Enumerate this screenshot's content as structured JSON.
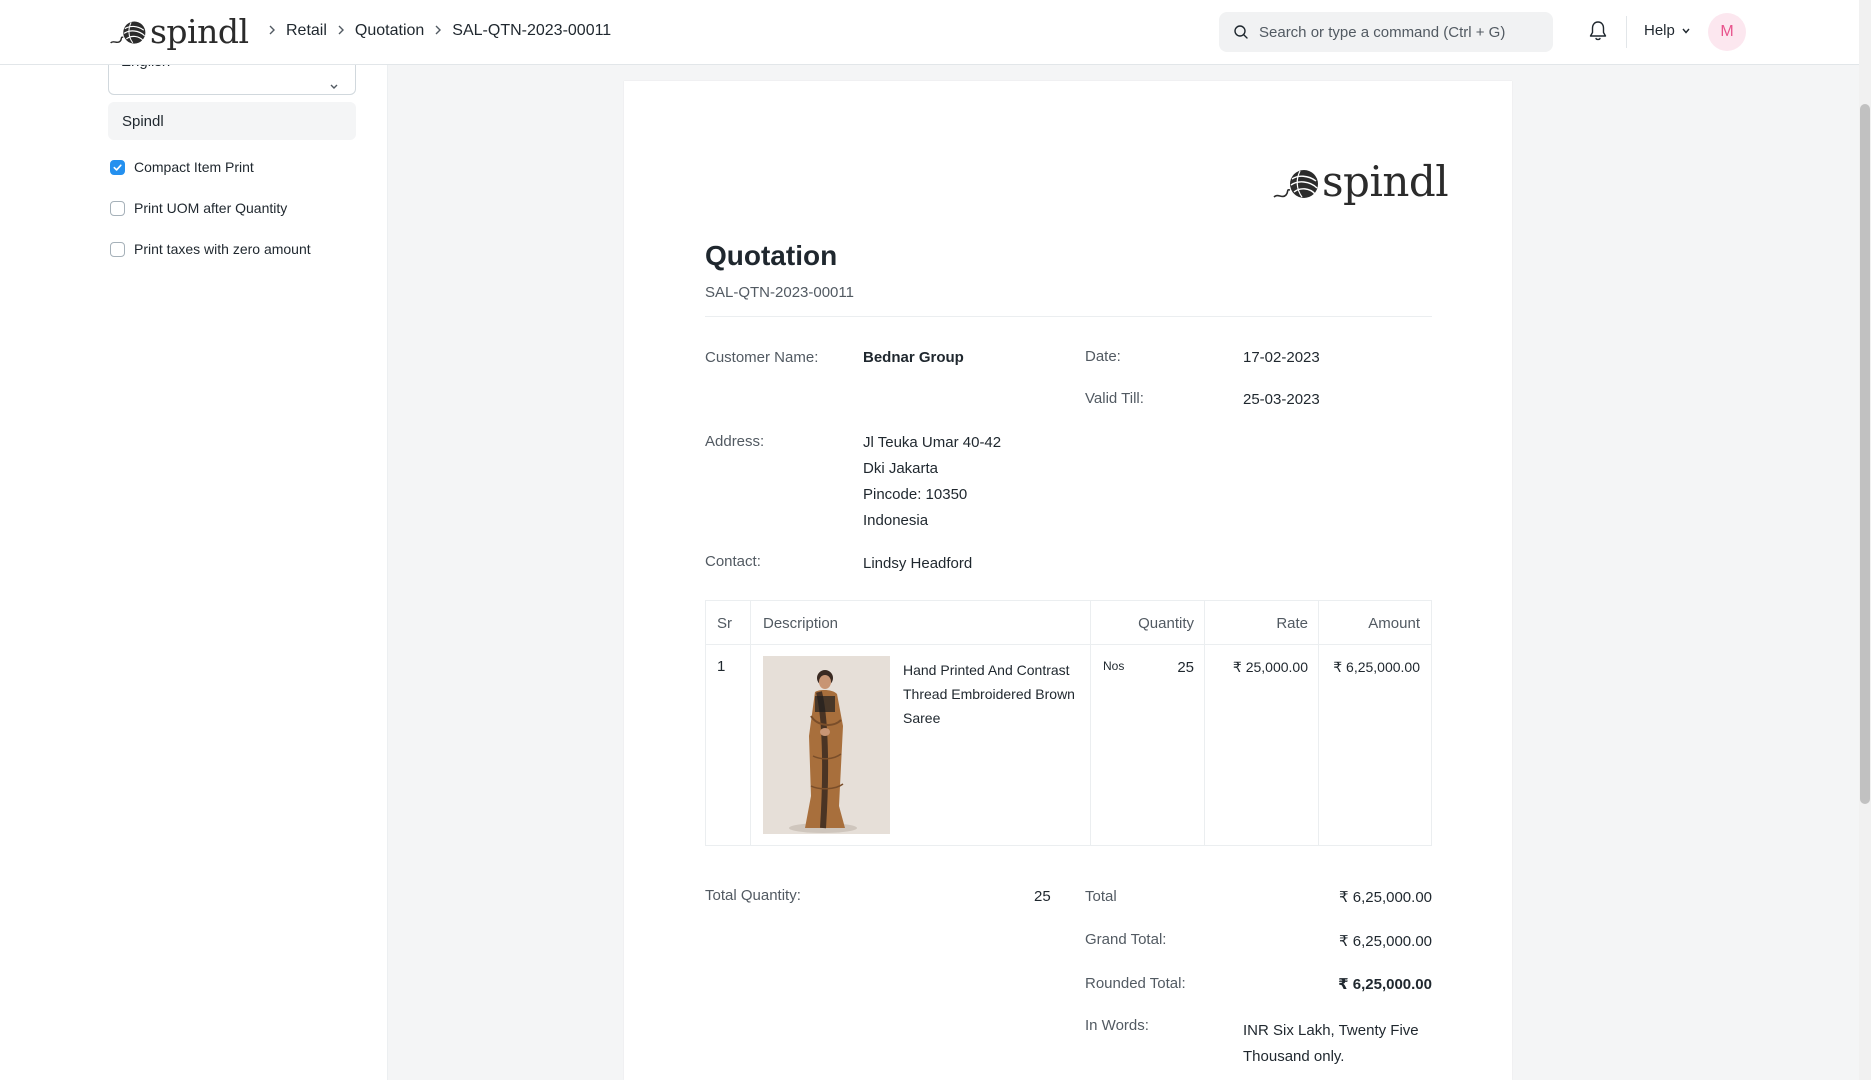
{
  "navbar": {
    "logo_text": "spindl",
    "breadcrumbs": [
      "Retail",
      "Quotation",
      "SAL-QTN-2023-00011"
    ],
    "search_placeholder": "Search or type a command (Ctrl + G)",
    "help_label": "Help",
    "avatar_initial": "M"
  },
  "sidebar": {
    "language_value": "English",
    "letterhead_value": "Spindl",
    "options": [
      {
        "label": "Compact Item Print",
        "checked": true
      },
      {
        "label": "Print UOM after Quantity",
        "checked": false
      },
      {
        "label": "Print taxes with zero amount",
        "checked": false
      }
    ]
  },
  "doc": {
    "logo_text": "spindl",
    "title": "Quotation",
    "id": "SAL-QTN-2023-00011",
    "customer_label": "Customer Name:",
    "customer_value": "Bednar Group",
    "date_label": "Date:",
    "date_value": "17-02-2023",
    "valid_label": "Valid Till:",
    "valid_value": "25-03-2023",
    "address_label": "Address:",
    "address_lines": [
      "Jl Teuka Umar 40-42",
      "Dki Jakarta",
      "Pincode: 10350",
      "Indonesia"
    ],
    "contact_label": "Contact:",
    "contact_value": "Lindsy Headford",
    "table": {
      "headers": [
        "Sr",
        "Description",
        "Quantity",
        "Rate",
        "Amount"
      ],
      "rows": [
        {
          "sr": "1",
          "description_lines": [
            "Hand Printed And Contrast",
            "Thread Embroidered Brown",
            "Saree"
          ],
          "uom": "Nos",
          "qty": "25",
          "rate": "₹ 25,000.00",
          "amount": "₹ 6,25,000.00"
        }
      ]
    },
    "total_qty_label": "Total Quantity:",
    "total_qty_value": "25",
    "total_label": "Total",
    "total_value": "₹ 6,25,000.00",
    "grand_total_label": "Grand Total:",
    "grand_total_value": "₹ 6,25,000.00",
    "rounded_total_label": "Rounded Total:",
    "rounded_total_value": "₹ 6,25,000.00",
    "in_words_label": "In Words:",
    "in_words_lines": [
      "INR Six Lakh, Twenty Five",
      "Thousand only."
    ]
  }
}
